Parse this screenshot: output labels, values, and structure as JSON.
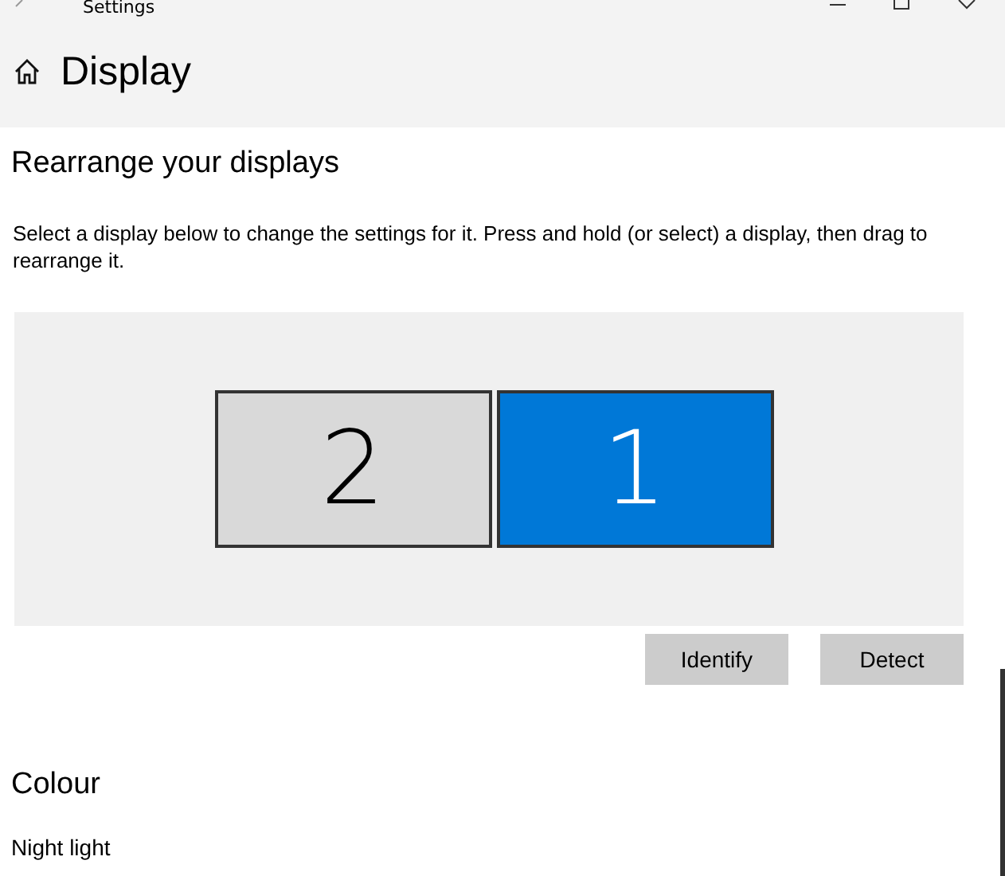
{
  "window": {
    "title": "Settings"
  },
  "page_title": "Display",
  "section": {
    "heading": "Rearrange your displays",
    "description": "Select a display below to change the settings for it. Press and hold (or select) a display, then drag to rearrange it."
  },
  "displays": [
    {
      "label": "2",
      "selected": false
    },
    {
      "label": "1",
      "selected": true
    }
  ],
  "buttons": [
    "Identify",
    "Detect"
  ],
  "colour_section": {
    "heading": "Colour",
    "item": "Night light"
  }
}
